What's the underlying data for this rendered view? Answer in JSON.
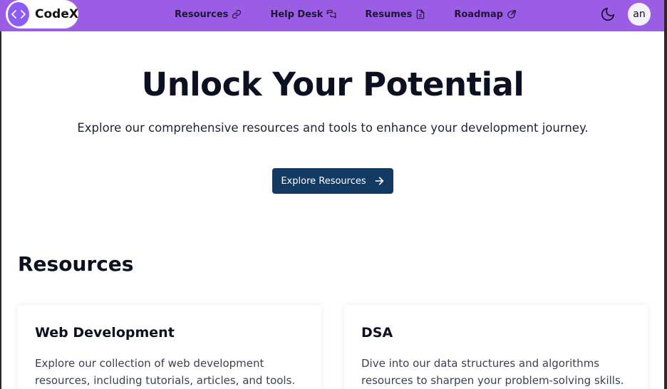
{
  "brand": {
    "name": "CodeX",
    "icon": "code-icon",
    "logo_color": "#8b5cf6"
  },
  "nav": {
    "background": "#9b5de5",
    "links": [
      {
        "label": "Resources",
        "icon": "link-icon"
      },
      {
        "label": "Help Desk",
        "icon": "chat-icon"
      },
      {
        "label": "Resumes",
        "icon": "file-icon"
      },
      {
        "label": "Roadmap",
        "icon": "external-link-icon"
      }
    ],
    "theme_toggle_icon": "moon-icon",
    "avatar_text": "an"
  },
  "hero": {
    "title": "Unlock Your Potential",
    "subtitle": "Explore our comprehensive resources and tools to enhance your development journey.",
    "cta_label": "Explore Resources",
    "cta_icon": "arrow-right-icon",
    "cta_color": "#133a63"
  },
  "resources": {
    "heading": "Resources",
    "cards": [
      {
        "title": "Web Development",
        "description": "Explore our collection of web development resources, including tutorials, articles, and tools."
      },
      {
        "title": "DSA",
        "description": "Dive into our data structures and algorithms resources to sharpen your problem-solving skills."
      }
    ]
  }
}
